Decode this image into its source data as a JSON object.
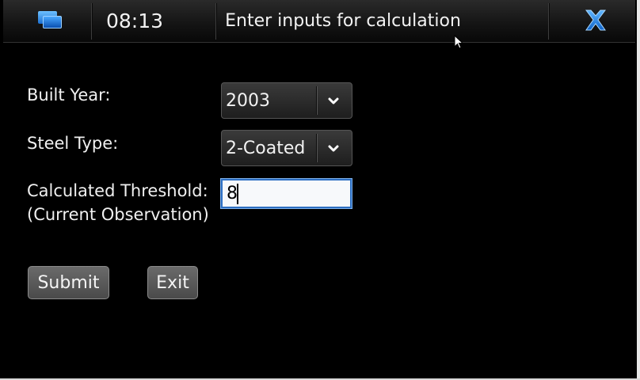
{
  "titlebar": {
    "task_switcher_icon": "task-switcher-icon",
    "time": "08:13",
    "title": "Enter inputs for calculation",
    "close_icon": "close-icon",
    "accent": "#1e7ff0"
  },
  "form": {
    "built_year": {
      "label": "Built Year:",
      "value": "2003",
      "icon": "chevron-down-icon"
    },
    "steel_type": {
      "label": "Steel Type:",
      "value": "2-Coated",
      "icon": "chevron-down-icon"
    },
    "threshold": {
      "label_line1": "Calculated Threshold:",
      "label_line2": "(Current Observation)",
      "value": "8"
    }
  },
  "buttons": {
    "submit": "Submit",
    "exit": "Exit"
  }
}
